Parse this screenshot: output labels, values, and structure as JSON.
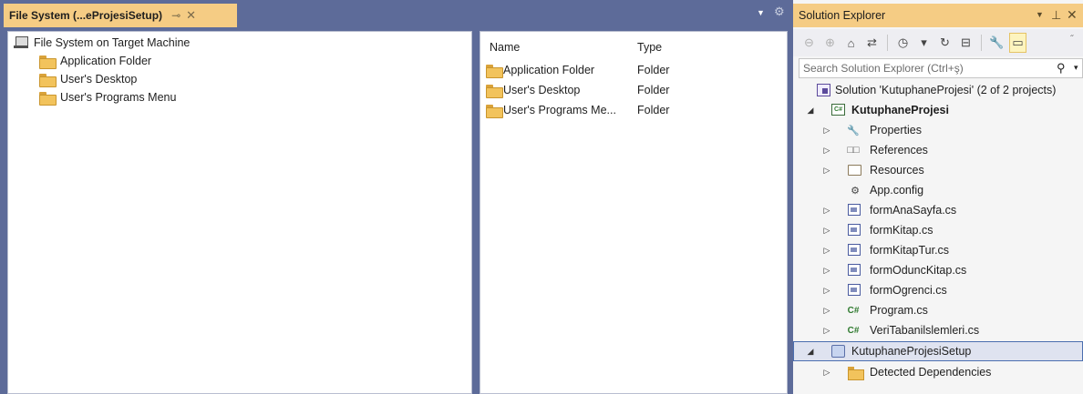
{
  "doc_tab": {
    "title": "File System (...eProjesiSetup)",
    "pin_icon": "pin-icon",
    "close_icon": "close-icon"
  },
  "file_system_tree": {
    "root": "File System on Target Machine",
    "children": [
      "Application Folder",
      "User's Desktop",
      "User's Programs Menu"
    ]
  },
  "file_list": {
    "columns": [
      "Name",
      "Type"
    ],
    "rows": [
      {
        "name": "Application Folder",
        "type": "Folder"
      },
      {
        "name": "User's Desktop",
        "type": "Folder"
      },
      {
        "name": "User's Programs Me...",
        "type": "Folder"
      }
    ]
  },
  "solution_explorer": {
    "title": "Solution Explorer",
    "search_placeholder": "Search Solution Explorer (Ctrl+ş)",
    "solution_label": "Solution 'KutuphaneProjesi' (2 of 2 projects)",
    "project1": {
      "name": "KutuphaneProjesi",
      "items": [
        {
          "label": "Properties",
          "icon": "wrench-icon",
          "expandable": true
        },
        {
          "label": "References",
          "icon": "references-icon",
          "expandable": true
        },
        {
          "label": "Resources",
          "icon": "folder-icon",
          "expandable": true
        },
        {
          "label": "App.config",
          "icon": "config-icon",
          "expandable": false
        },
        {
          "label": "formAnaSayfa.cs",
          "icon": "form-icon",
          "expandable": true
        },
        {
          "label": "formKitap.cs",
          "icon": "form-icon",
          "expandable": true
        },
        {
          "label": "formKitapTur.cs",
          "icon": "form-icon",
          "expandable": true
        },
        {
          "label": "formOduncKitap.cs",
          "icon": "form-icon",
          "expandable": true
        },
        {
          "label": "formOgrenci.cs",
          "icon": "form-icon",
          "expandable": true
        },
        {
          "label": "Program.cs",
          "icon": "csharp-icon",
          "expandable": true
        },
        {
          "label": "VeriTabanilslemleri.cs",
          "icon": "csharp-icon",
          "expandable": true
        }
      ]
    },
    "project2": {
      "name": "KutuphaneProjesiSetup",
      "items": [
        {
          "label": "Detected Dependencies",
          "icon": "folder-icon",
          "expandable": true
        }
      ]
    }
  },
  "colors": {
    "frame": "#5d6b99",
    "active_tab": "#f5cc84",
    "pane_bg": "#ffffff",
    "explorer_bg": "#f5f5f5",
    "selection_border": "#4b6eaf"
  }
}
